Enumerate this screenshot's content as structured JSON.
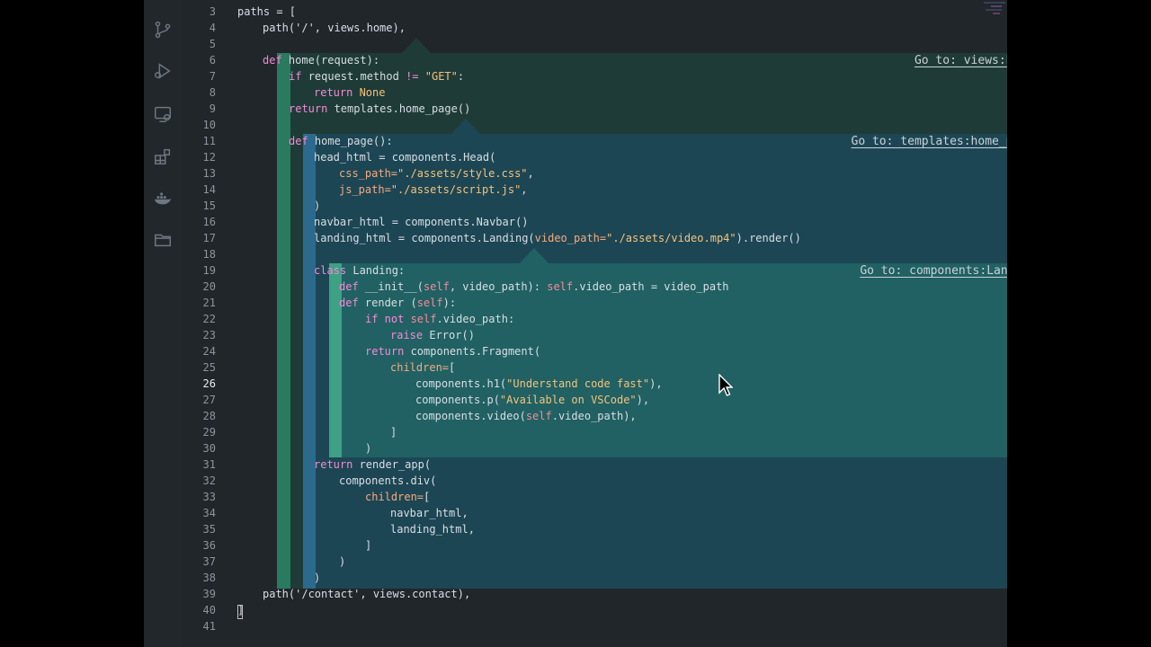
{
  "activity_bar": {
    "icons": [
      "source-control-icon",
      "run-debug-icon",
      "remote-explorer-icon",
      "extensions-icon",
      "docker-icon",
      "folder-icon"
    ]
  },
  "peeks": {
    "views": {
      "goto": "Go to: views:home"
    },
    "templates": {
      "goto": "Go to: templates:home_page"
    },
    "components": {
      "goto": "Go to: components:Landing"
    }
  },
  "line_numbers": [
    "3",
    "4",
    "5",
    "6",
    "7",
    "8",
    "9",
    "10",
    "11",
    "12",
    "13",
    "14",
    "15",
    "16",
    "17",
    "18",
    "19",
    "20",
    "21",
    "22",
    "23",
    "24",
    "25",
    "26",
    "27",
    "28",
    "29",
    "30",
    "31",
    "32",
    "33",
    "34",
    "35",
    "36",
    "37",
    "38",
    "39",
    "40",
    "41"
  ],
  "code": {
    "l3": "paths = [",
    "l4": "path('/', views.home),",
    "l6a": "def ",
    "l6b": "home(request):",
    "l7a": "if ",
    "l7b": "request.method ",
    "l7c": "!= ",
    "l7d": "\"GET\"",
    "l7e": ":",
    "l8a": "return ",
    "l8b": "None",
    "l9a": "return ",
    "l9b": "templates.home_page()",
    "l11a": "def ",
    "l11b": "home_page():",
    "l12": "head_html = components.Head(",
    "l13a": "css_path=",
    "l13b": "\"./assets/style.css\"",
    "l13c": ",",
    "l14a": "js_path=",
    "l14b": "\"./assets/script.js\"",
    "l14c": ",",
    "l15": ")",
    "l16": "navbar_html = components.Navbar()",
    "l17a": "landing_html = components.Landing(",
    "l17b": "video_path=",
    "l17c": "\"./assets/video.mp4\"",
    "l17d": ").render()",
    "l19a": "class ",
    "l19b": "Landing:",
    "l20a": "def ",
    "l20b": "__init__(",
    "l20c": "self",
    "l20d": ", video_path): ",
    "l20e": "self",
    "l20f": ".video_path = video_path",
    "l21a": "def ",
    "l21b": "render (",
    "l21c": "self",
    "l21d": "):",
    "l22a": "if not ",
    "l22b": "self",
    "l22c": ".video_path:",
    "l23a": "raise ",
    "l23b": "Error()",
    "l24a": "return ",
    "l24b": "components.Fragment(",
    "l25a": "children=",
    "l25b": "[",
    "l26a": "components.h1(",
    "l26b": "\"Understand code fast\"",
    "l26c": "),",
    "l27a": "components.p(",
    "l27b": "\"Available on VSCode\"",
    "l27c": "),",
    "l28a": "components.video(",
    "l28b": "self",
    "l28c": ".video_path),",
    "l29": "]",
    "l30": ")",
    "l31a": "return ",
    "l31b": "render_app(",
    "l32": "components.div(",
    "l33a": "children=",
    "l33b": "[",
    "l34": "navbar_html,",
    "l35": "landing_html,",
    "l36": "]",
    "l37": ")",
    "l38": ")",
    "l39": "path('/contact', views.contact),",
    "l40": "]"
  }
}
